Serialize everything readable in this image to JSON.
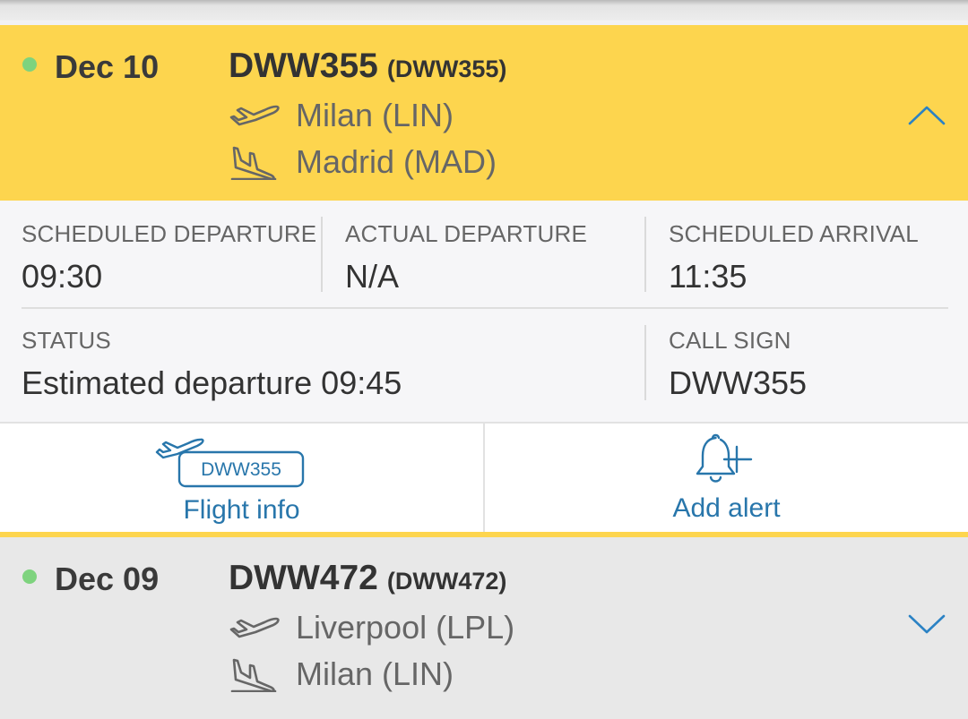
{
  "flights": [
    {
      "date": "Dec 10",
      "flight_number": "DWW355",
      "callsign_paren": "(DWW355)",
      "origin": "Milan (LIN)",
      "destination": "Madrid (MAD)",
      "status_dot_color": "#7ed37e",
      "expanded": true
    },
    {
      "date": "Dec 09",
      "flight_number": "DWW472",
      "callsign_paren": "(DWW472)",
      "origin": "Liverpool (LPL)",
      "destination": "Milan (LIN)",
      "status_dot_color": "#7ed37e",
      "expanded": false
    }
  ],
  "details": {
    "scheduled_departure_label": "SCHEDULED DEPARTURE",
    "scheduled_departure_value": "09:30",
    "actual_departure_label": "ACTUAL DEPARTURE",
    "actual_departure_value": "N/A",
    "scheduled_arrival_label": "SCHEDULED ARRIVAL",
    "scheduled_arrival_value": "11:35",
    "status_label": "STATUS",
    "status_value": "Estimated departure 09:45",
    "call_sign_label": "CALL SIGN",
    "call_sign_value": "DWW355"
  },
  "actions": {
    "flight_info_badge": "DWW355",
    "flight_info_label": "Flight info",
    "add_alert_label": "Add alert"
  },
  "colors": {
    "accent_yellow": "#fdd54e",
    "link_blue": "#2876ab"
  },
  "icons": [
    "departure-plane-icon",
    "arrival-plane-icon",
    "chevron-up-icon",
    "chevron-down-icon",
    "flight-info-plane-icon",
    "bell-plus-icon"
  ]
}
